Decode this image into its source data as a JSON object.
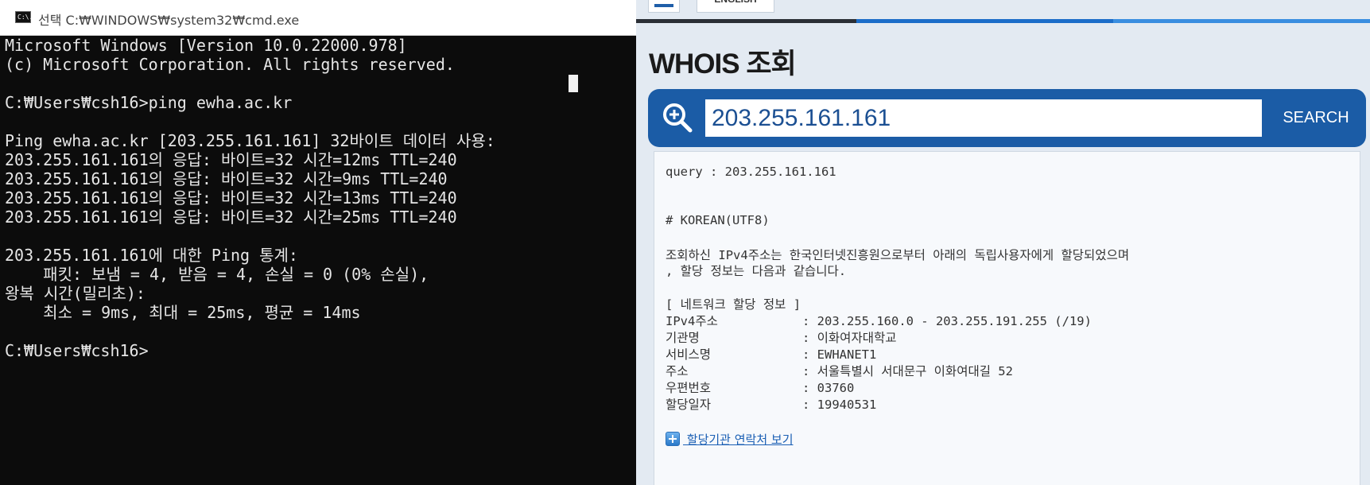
{
  "cmd": {
    "title": "선택 C:₩WINDOWS₩system32₩cmd.exe",
    "icon_label": "C:\\.",
    "lines": [
      "Microsoft Windows [Version 10.0.22000.978]",
      "(c) Microsoft Corporation. All rights reserved.",
      "",
      "C:₩Users₩csh16>ping ewha.ac.kr",
      "",
      "Ping ewha.ac.kr [203.255.161.161] 32바이트 데이터 사용:",
      "203.255.161.161의 응답: 바이트=32 시간=12ms TTL=240",
      "203.255.161.161의 응답: 바이트=32 시간=9ms TTL=240",
      "203.255.161.161의 응답: 바이트=32 시간=13ms TTL=240",
      "203.255.161.161의 응답: 바이트=32 시간=25ms TTL=240",
      "",
      "203.255.161.161에 대한 Ping 통계:",
      "    패킷: 보냄 = 4, 받음 = 4, 손실 = 0 (0% 손실),",
      "왕복 시간(밀리초):",
      "    최소 = 9ms, 최대 = 25ms, 평균 = 14ms",
      "",
      "C:₩Users₩csh16>"
    ]
  },
  "web": {
    "language_label": "ENGLISH",
    "heading": "WHOIS 조회",
    "search": {
      "value": "203.255.161.161",
      "button_label": "SEARCH"
    },
    "result": {
      "query_line": "query : 203.255.161.161",
      "section_line": "# KOREAN(UTF8)",
      "intro_line1": "조회하신 IPv4주소는 한국인터넷진흥원으로부터 아래의 독립사용자에게 할당되었으며",
      "intro_line2": ", 할당 정보는 다음과 같습니다.",
      "block_title": "[ 네트워크 할당 정보 ]",
      "rows": [
        {
          "key": "IPv4주소",
          "value": ": 203.255.160.0 - 203.255.191.255 (/19)"
        },
        {
          "key": "기관명",
          "value": ": 이화여자대학교"
        },
        {
          "key": "서비스명",
          "value": ": EWHANET1"
        },
        {
          "key": "주소",
          "value": ": 서울특별시 서대문구 이화여대길 52"
        },
        {
          "key": "우편번호",
          "value": ": 03760"
        },
        {
          "key": "할당일자",
          "value": ": 19940531"
        }
      ],
      "contact_link": " 할당기관 연락처 보기"
    }
  },
  "colors": {
    "terminal_bg": "#0c0c0c",
    "terminal_text": "#e6e6e6",
    "search_bar": "#1b5ca6",
    "link": "#1a5fb4"
  }
}
